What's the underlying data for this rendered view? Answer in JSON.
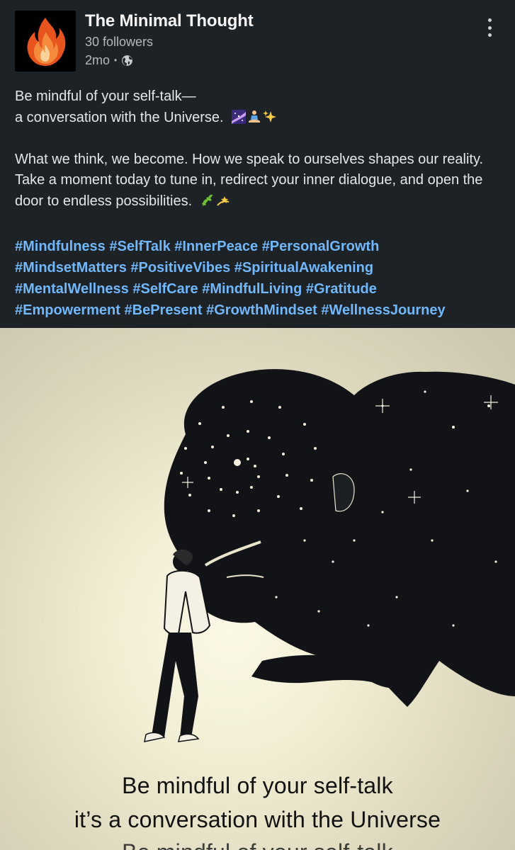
{
  "author": {
    "name": "The Minimal Thought",
    "followers": "30 followers",
    "time": "2mo",
    "separator": "•",
    "visibility_icon": "globe-icon",
    "avatar_icon": "flame-icon"
  },
  "menu_icon": "more-vertical-icon",
  "post": {
    "line1": "Be mindful of your self-talk—",
    "line2": "a conversation with the Universe.",
    "line2_emojis": [
      "milky-way-emoji",
      "person-meditating-emoji",
      "sparkles-emoji"
    ],
    "para2": "What we think, we become. How we speak to ourselves shapes our reality. Take a moment today to tune in, redirect your inner dialogue, and open the door to endless possibilities.",
    "para2_emojis": [
      "herb-emoji",
      "dizzy-emoji"
    ],
    "hashtags": [
      "#Mindfulness",
      "#SelfTalk",
      "#InnerPeace",
      "#PersonalGrowth",
      "#MindsetMatters",
      "#PositiveVibes",
      "#SpiritualAwakening",
      "#MentalWellness",
      "#SelfCare",
      "#MindfulLiving",
      "#Gratitude",
      "#Empowerment",
      "#BePresent",
      "#GrowthMindset",
      "#WellnessJourney"
    ]
  },
  "image": {
    "caption_line1": "Be mindful of your self-talk",
    "caption_line2": "it’s a conversation with the Universe",
    "caption_line3": "Be mindful of your self-talk"
  },
  "colors": {
    "background": "#1d2226",
    "hashtag": "#71b7fb",
    "text": "#e5e6e7",
    "muted": "#b6b9bc"
  }
}
